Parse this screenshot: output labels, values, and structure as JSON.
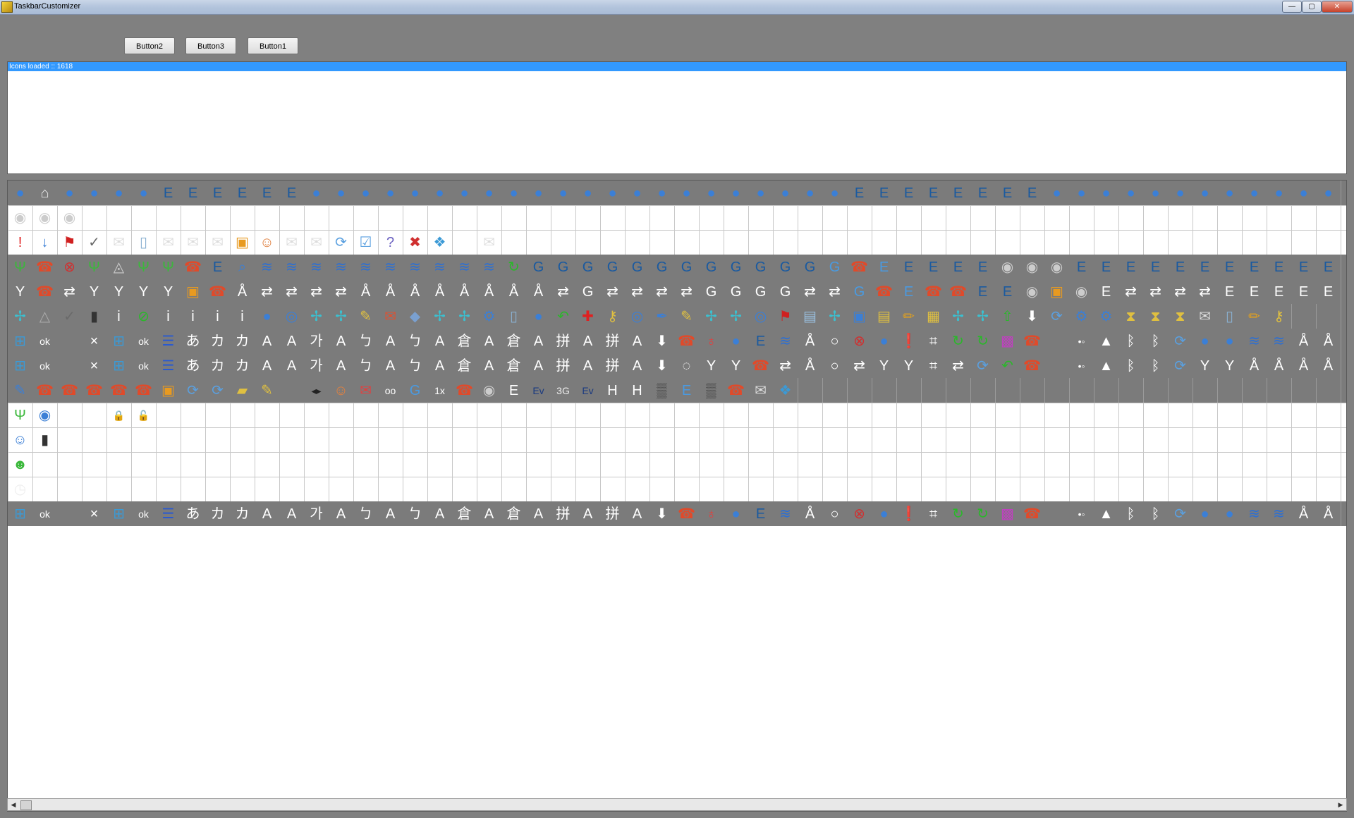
{
  "window": {
    "title": "TaskbarCustomizer",
    "min_label": "—",
    "max_label": "▢",
    "close_label": "✕"
  },
  "toolbar": {
    "button2_label": "Button2",
    "button3_label": "Button3",
    "button1_label": "Button1"
  },
  "log": {
    "line": "Icons loaded :: 1618"
  },
  "colors": {
    "window_bg": "#808080",
    "selection": "#3399ff",
    "grid_line": "#c8c8c8"
  },
  "icon_rows": [
    {
      "dark": true,
      "icons": [
        "globe-x-icon",
        "network-icon",
        "globe-blocked-icon",
        "globe-icon",
        "globe-icon",
        "globe-icon",
        "globe-signal-icon",
        "globe-signal-icon",
        "phone-signal-icon",
        "phone-signal-icon",
        "phone-signal-icon",
        "phone-signal-icon",
        "globe-icon",
        "globe-icon",
        "globe-icon",
        "globe-icon",
        "globe-icon",
        "globe-icon",
        "globe-icon",
        "globe-icon",
        "globe-icon",
        "globe-icon",
        "globe-icon",
        "globe-icon",
        "globe-icon",
        "globe-icon",
        "globe-icon",
        "globe-icon",
        "globe-icon",
        "globe-icon",
        "globe-icon",
        "globe-icon",
        "globe-icon",
        "globe-icon",
        "globe-signal-icon",
        "phone-signal-icon",
        "phone-signal-icon",
        "phone-signal-icon",
        "phone-signal-icon",
        "phone-signal-icon",
        "phone-signal-icon",
        "phone-signal-icon",
        "globe-icon",
        "globe-icon",
        "globe-icon",
        "globe-icon",
        "globe-icon",
        "globe-icon",
        "globe-icon",
        "globe-icon",
        "globe-icon",
        "globe-icon",
        "globe-icon",
        "globe-icon",
        "globe-icon"
      ]
    },
    {
      "dark": false,
      "icons": [
        "speaker-icon",
        "speaker-muted-icon",
        "speaker-icon"
      ]
    },
    {
      "dark": false,
      "icons": [
        "exclamation-icon",
        "down-arrow-icon",
        "flag-icon",
        "checkmark-icon",
        "mail-icon",
        "phone-device-icon",
        "mail-open-icon",
        "mail-icon",
        "mail-add-icon",
        "sim-icon",
        "contact-icon",
        "mail-open-icon",
        "mail-icon",
        "sync-icon",
        "checklist-icon",
        "help-icon",
        "delete-icon",
        "chat-icon",
        "info-bubble-icon",
        "mail-add-icon"
      ]
    },
    {
      "dark": true,
      "icons": [
        "antenna-icon",
        "phone-x-icon",
        "close-circle-icon",
        "antenna-icon",
        "satellite-icon",
        "antenna-icon",
        "antenna-alert-icon",
        "sim-phone-icon",
        "phone-signal-icon",
        "search-icon",
        "wifi-icon",
        "wifi-icon",
        "wifi-icon",
        "wifi-icon",
        "wifi-icon",
        "wifi-icon",
        "wifi-icon",
        "wifi-icon",
        "wifi-icon",
        "wifi-icon",
        "refresh-icon",
        "g-signal-icon",
        "g-signal-icon",
        "g-signal-icon",
        "g-signal-icon",
        "g-signal-icon",
        "g-signal-icon",
        "g-signal-icon",
        "g-signal-icon",
        "g-signal-icon",
        "g-signal-icon",
        "g-signal-icon",
        "g-signal-icon",
        "g-box-icon",
        "phone-alert-icon",
        "e-box-icon",
        "phone-signal-icon",
        "phone-signal-icon",
        "phone-signal-icon",
        "phone-signal-icon",
        "speaker-icon",
        "speaker-icon",
        "speaker-muted-icon",
        "e-signal-icon",
        "e-signal-icon",
        "e-signal-icon",
        "e-signal-icon",
        "e-signal-icon",
        "e-signal-icon",
        "e-signal-icon",
        "e-signal-icon",
        "e-signal-icon",
        "e-signal-icon",
        "e-signal-icon",
        "e-signal-icon",
        "e-signal-icon"
      ]
    },
    {
      "dark": true,
      "icons": [
        "filter-x-icon",
        "phone-icon",
        "arrows-x-icon",
        "filter-icon",
        "filter-icon",
        "filter-icon",
        "filter-alert-icon",
        "sim-card-icon",
        "phone-icon",
        "tower-icon",
        "tower-arrows-icon",
        "tower-arrows-icon",
        "tower-arrows-icon",
        "tower-arrows-icon",
        "tower-icon",
        "tower-icon",
        "tower-icon",
        "tower-icon",
        "tower-icon",
        "tower-icon",
        "tower-icon",
        "tower-icon",
        "arrows-icon",
        "g-letter-icon",
        "g-arrows-icon",
        "g-arrows-icon",
        "g-arrows-icon",
        "g-arrows-icon",
        "g-letter-icon",
        "g-letter-icon",
        "g-letter-icon",
        "g-letter-icon",
        "g-arrows-icon",
        "g-arrows-icon",
        "g-box-outline-icon",
        "phone-icon",
        "e-box-outline-icon",
        "phone-icon",
        "phone-icon",
        "phone-signal-icon",
        "phone-signal-icon",
        "speaker-icon",
        "sim-icon",
        "speaker-muted-icon",
        "e-letter-icon",
        "e-arrows-icon",
        "e-arrows-icon",
        "e-arrows-icon",
        "e-arrows-icon",
        "e-letter-icon",
        "e-letter-icon",
        "e-letter-icon",
        "e-letter-icon",
        "e-letter-icon",
        "e-letter-icon"
      ]
    },
    {
      "dark": true,
      "icons": [
        "move-icon",
        "warning-icon",
        "checkmark-icon",
        "battery-icon",
        "info-icon",
        "slash-icon",
        "info-icon",
        "info-icon",
        "info-icon",
        "info-icon",
        "globe-icon",
        "rss-icon",
        "move-icon",
        "move-icon",
        "notes-icon",
        "mailbox-icon",
        "cube-icon",
        "move-icon",
        "move-icon",
        "gear-icon",
        "device-icon",
        "globe-icon",
        "undo-icon",
        "plus-icon",
        "key-icon",
        "rss-icon",
        "pen-icon",
        "notes-icon",
        "move-icon",
        "move-icon",
        "rss-icon",
        "flag-icon",
        "document-icon",
        "move-icon",
        "photo-icon",
        "clipboard-icon",
        "pencil-icon",
        "book-icon",
        "move-icon",
        "move-icon",
        "upload-icon",
        "download-icon",
        "sync-icon",
        "gear-icon",
        "gear-icon",
        "hourglass-icon",
        "hourglass-icon",
        "hourglass-icon",
        "mail-icon",
        "phone-device-icon",
        "pencil-icon",
        "key-icon"
      ]
    },
    {
      "dark": true,
      "icons": [
        "windows-icon",
        "ok-text-icon",
        "blank-icon",
        "close-icon",
        "windows-icon",
        "ok-icon",
        "keyboard-icon",
        "hiragana-icon",
        "katakana-icon",
        "katakana-icon",
        "alpha-icon",
        "alpha-icon",
        "hangul-icon",
        "alpha-icon",
        "bopomofo-icon",
        "alpha-icon",
        "bopomofo-icon",
        "alpha-icon",
        "cangjie-icon",
        "alpha-icon",
        "cangjie-icon",
        "alpha-icon",
        "pinyin-icon",
        "alpha-icon",
        "pinyin-icon",
        "alpha-icon",
        "download-icon",
        "phone-up-icon",
        "balloon-icon",
        "globe-icon",
        "phone-signal-icon",
        "wifi-icon",
        "tower-icon",
        "circle-icon",
        "close-circle-icon",
        "globe-icon",
        "alert-icon",
        "crop-icon",
        "refresh-icon",
        "refresh-icon",
        "mms-icon",
        "phone-icon",
        "blank-icon",
        "dot-signal-icon",
        "triangle-icon",
        "bluetooth-icon",
        "bluetooth-icon",
        "sync-icon",
        "globe-icon",
        "globe-icon",
        "wifi-icon",
        "wifi-icon",
        "tower-icon",
        "tower-icon",
        "tower-icon"
      ]
    },
    {
      "dark": true,
      "icons": [
        "windows-icon",
        "ok-text-icon",
        "blank-icon",
        "close-icon",
        "windows-icon",
        "ok-icon",
        "keyboard-icon",
        "hiragana-icon",
        "katakana-icon",
        "katakana-icon",
        "alpha-icon",
        "alpha-icon",
        "hangul-icon",
        "alpha-icon",
        "bopomofo-icon",
        "alpha-icon",
        "bopomofo-icon",
        "alpha-icon",
        "cangjie-icon",
        "alpha-icon",
        "cangjie-icon",
        "alpha-icon",
        "pinyin-icon",
        "alpha-icon",
        "pinyin-icon",
        "alpha-icon",
        "download-icon",
        "speech-icon",
        "filter-x-icon",
        "filter-icon",
        "phone-icon",
        "tower-arrows-icon",
        "tower-icon",
        "circle-icon",
        "arrows-x-icon",
        "filter-icon",
        "filter-alert-icon",
        "crop-icon",
        "arrows-icon",
        "sync-icon",
        "undo-icon",
        "phone-icon",
        "blank-icon",
        "dot-signal-icon",
        "triangle-icon",
        "bluetooth-icon",
        "bluetooth-icon",
        "sync-icon",
        "filter-icon",
        "filter-icon",
        "tower-icon",
        "tower-icon",
        "tower-icon",
        "tower-icon",
        "tower-icon"
      ]
    },
    {
      "dark": true,
      "icons": [
        "notepad-icon",
        "phone-in-icon",
        "phone-out-icon",
        "phone-in-icon",
        "phone-out-icon",
        "phone-alert-icon",
        "sim-icon",
        "sync-icon",
        "sync-icon",
        "folder-icon",
        "notes-icon",
        "blank-icon",
        "left-right-icon",
        "contact-icon",
        "voicemail-icon",
        "voicemail-tape-icon",
        "g-box-icon",
        "onex-icon",
        "phone-alert-icon",
        "speaker-icon",
        "e-letter-icon",
        "ev-icon",
        "threeg-icon",
        "ev-icon",
        "h-letter-icon",
        "h-box-icon",
        "pattern-icon",
        "e-box-icon",
        "pattern-icon",
        "phone-icon",
        "mail-open-icon",
        "chat-icon"
      ]
    },
    {
      "dark": false,
      "icons": [
        "antenna-icon",
        "broadcast-icon",
        "left-arrow-icon",
        "right-arrow-icon",
        "lock-icon",
        "unlock-icon"
      ]
    },
    {
      "dark": false,
      "icons": [
        "user-chat-icon",
        "battery-icon"
      ]
    },
    {
      "dark": false,
      "icons": [
        "users-icon"
      ]
    },
    {
      "dark": false,
      "icons": [
        "clock-icon"
      ]
    },
    {
      "dark": true,
      "icons": [
        "windows-icon",
        "ok-text-icon",
        "blank-icon",
        "close-icon",
        "windows-icon",
        "ok-icon",
        "keyboard-icon",
        "hiragana-icon",
        "katakana-icon",
        "katakana-icon",
        "alpha-icon",
        "alpha-icon",
        "hangul-icon",
        "alpha-icon",
        "bopomofo-icon",
        "alpha-icon",
        "bopomofo-icon",
        "alpha-icon",
        "cangjie-icon",
        "alpha-icon",
        "cangjie-icon",
        "alpha-icon",
        "pinyin-icon",
        "alpha-icon",
        "pinyin-icon",
        "alpha-icon",
        "download-icon",
        "phone-up-icon",
        "balloon-icon",
        "globe-icon",
        "phone-signal-icon",
        "wifi-icon",
        "tower-icon",
        "circle-icon",
        "close-circle-icon",
        "globe-icon",
        "alert-icon",
        "crop-icon",
        "refresh-icon",
        "refresh-icon",
        "mms-icon",
        "phone-icon",
        "blank-icon",
        "dot-signal-icon",
        "triangle-icon",
        "bluetooth-icon",
        "bluetooth-icon",
        "sync-icon",
        "globe-icon",
        "globe-icon",
        "wifi-icon",
        "wifi-icon",
        "tower-icon",
        "tower-icon",
        "tower-icon"
      ]
    }
  ]
}
